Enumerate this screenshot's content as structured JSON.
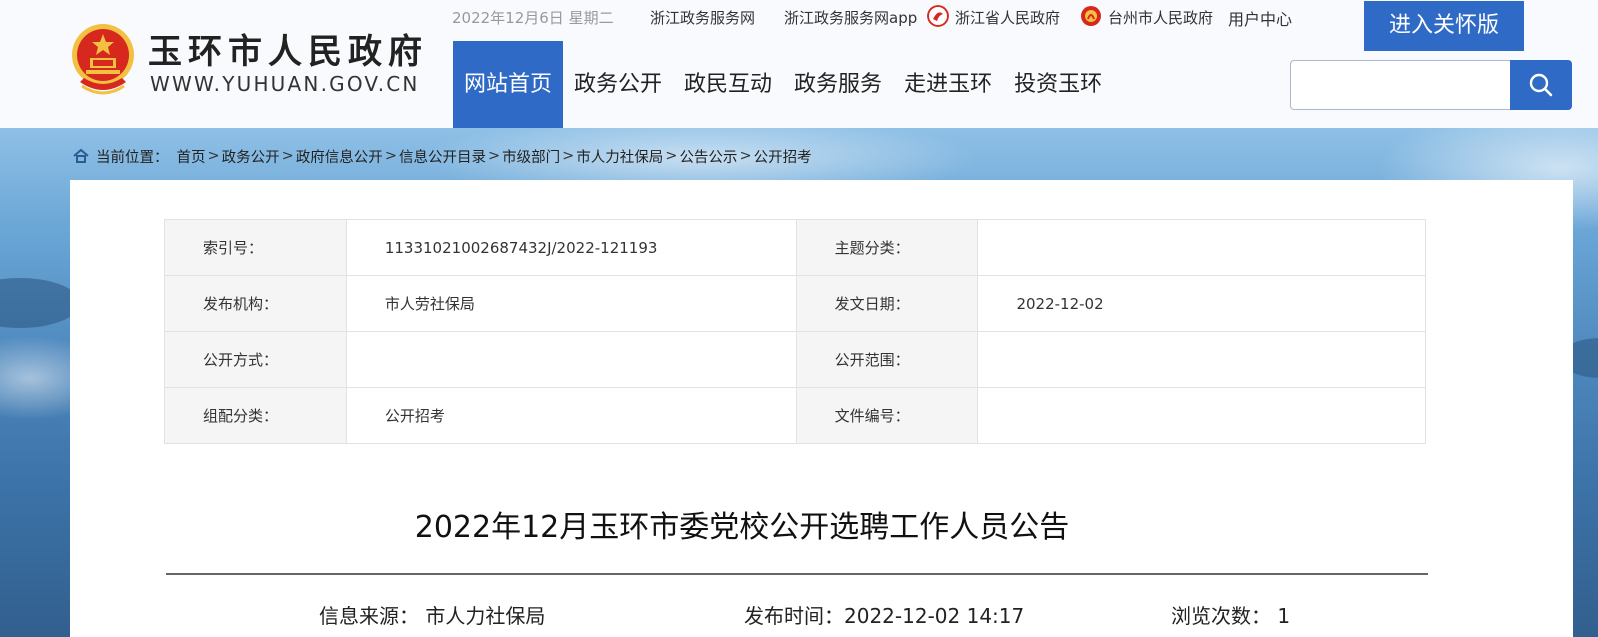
{
  "site": {
    "name": "玉环市人民政府",
    "domain": "WWW.YUHUAN.GOV.CN"
  },
  "topbar": {
    "date": "2022年12月6日 星期二",
    "links": [
      "浙江政务服务网",
      "浙江政务服务网app",
      "浙江省人民政府",
      "台州市人民政府",
      "用户中心"
    ]
  },
  "care_button": "进入关怀版",
  "nav": {
    "items": [
      "网站首页",
      "政务公开",
      "政民互动",
      "政务服务",
      "走进玉环",
      "投资玉环"
    ],
    "active": "网站首页"
  },
  "search": {
    "placeholder": "",
    "value": ""
  },
  "breadcrumb": {
    "prefix": "当前位置：",
    "items": [
      "首页",
      "政务公开",
      "政府信息公开",
      "信息公开目录",
      "市级部门",
      "市人力社保局",
      "公告公示",
      "公开招考"
    ],
    "separator": ">"
  },
  "meta_table": {
    "rows": [
      {
        "k1": "索引号：",
        "v1": "11331021002687432J/2022-121193",
        "k2": "主题分类：",
        "v2": ""
      },
      {
        "k1": "发布机构：",
        "v1": "市人劳社保局",
        "k2": "发文日期：",
        "v2": "2022-12-02"
      },
      {
        "k1": "公开方式：",
        "v1": "",
        "k2": "公开范围：",
        "v2": ""
      },
      {
        "k1": "组配分类：",
        "v1": "公开招考",
        "k2": "文件编号：",
        "v2": ""
      }
    ]
  },
  "article": {
    "title": "2022年12月玉环市委党校公开选聘工作人员公告",
    "source_label": "信息来源：",
    "source": "市人力社保局",
    "publish_label": "发布时间：",
    "publish_time": "2022-12-02 14:17",
    "views_label": "浏览次数：",
    "views": "1"
  },
  "colors": {
    "primary": "#2f6bc6",
    "emblem_red": "#d7281e",
    "emblem_gold": "#f3c142"
  }
}
